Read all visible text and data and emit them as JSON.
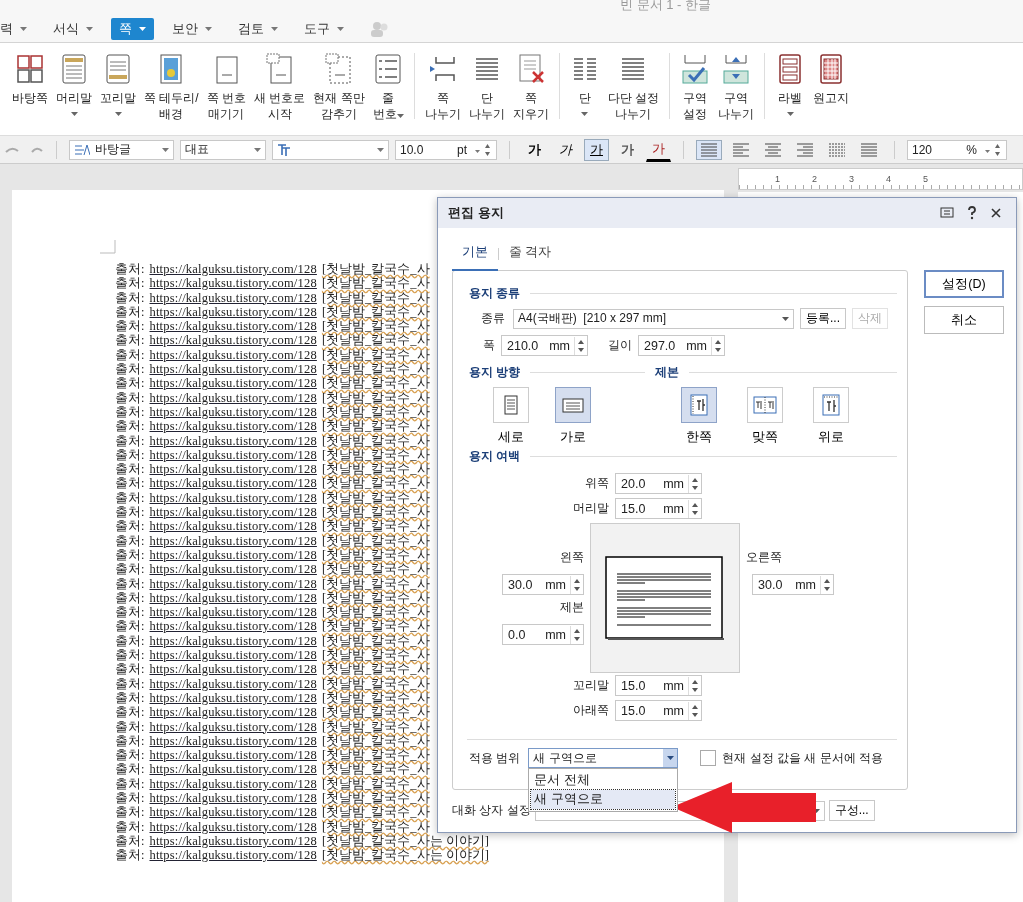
{
  "window": {
    "title": "빈 문서 1 - 한글"
  },
  "menu": [
    {
      "label": "력",
      "selected": false
    },
    {
      "label": "서식",
      "selected": false
    },
    {
      "label": "쪽",
      "selected": true
    },
    {
      "label": "보안",
      "selected": false
    },
    {
      "label": "검토",
      "selected": false
    },
    {
      "label": "도구",
      "selected": false
    }
  ],
  "ribbon": {
    "groups": [
      [
        {
          "label": "바탕쪽",
          "kind": "master",
          "dropdown": false
        },
        {
          "label": "머리말",
          "kind": "header",
          "dropdown": true
        },
        {
          "label": "꼬리말",
          "kind": "footer",
          "dropdown": true
        },
        {
          "label": "쪽 테두리/\n배경",
          "kind": "border",
          "dropdown": false
        },
        {
          "label": "쪽 번호\n매기기",
          "kind": "pagenum",
          "dropdown": false
        },
        {
          "label": "새 번호로\n시작",
          "kind": "newnum",
          "dropdown": false
        },
        {
          "label": "현재 쪽만\n감추기",
          "kind": "hide",
          "dropdown": false
        },
        {
          "label": "줄\n번호",
          "kind": "linenum",
          "dropdown": true
        }
      ],
      [
        {
          "label": "쪽\n나누기",
          "kind": "pagebreak",
          "dropdown": false
        },
        {
          "label": "단\n나누기",
          "kind": "colbreak",
          "dropdown": false
        },
        {
          "label": "쪽\n지우기",
          "kind": "delpage",
          "dropdown": false
        }
      ],
      [
        {
          "label": "단",
          "kind": "columns",
          "dropdown": true
        },
        {
          "label": "다단 설정\n나누기",
          "kind": "multicol",
          "dropdown": false
        }
      ],
      [
        {
          "label": "구역\n설정",
          "kind": "section",
          "dropdown": false
        },
        {
          "label": "구역\n나누기",
          "kind": "sectionbreak",
          "dropdown": false
        }
      ],
      [
        {
          "label": "라벨",
          "kind": "label",
          "dropdown": true
        },
        {
          "label": "원고지",
          "kind": "manuscript",
          "dropdown": false
        }
      ]
    ]
  },
  "format_toolbar": {
    "style": "바탕글",
    "font_group": "대표",
    "size": "10.0",
    "size_unit": "pt",
    "char_buttons": [
      {
        "label": "가",
        "kind": "bold",
        "selected": false
      },
      {
        "label": "가",
        "kind": "italic",
        "selected": false
      },
      {
        "label": "가",
        "kind": "underline",
        "selected": true
      },
      {
        "label": "가",
        "kind": "outline",
        "selected": false
      },
      {
        "label": "가",
        "kind": "color",
        "selected": false
      }
    ],
    "align": [
      {
        "kind": "justify",
        "selected": true
      },
      {
        "kind": "left",
        "selected": false
      },
      {
        "kind": "center",
        "selected": false
      },
      {
        "kind": "right",
        "selected": false
      },
      {
        "kind": "distribute",
        "selected": false
      },
      {
        "kind": "divide",
        "selected": false
      }
    ],
    "zoom": "120",
    "zoom_unit": "%"
  },
  "ruler": {
    "labels": [
      "1",
      "2",
      "3",
      "4",
      "5"
    ]
  },
  "document": {
    "lines": [
      {
        "prefix": "출처:",
        "url": "https://kalguksu.tistory.com/128",
        "title": "[첫날밤_칼국수_사"
      },
      {
        "prefix": "출처:",
        "url": "https://kalguksu.tistory.com/128",
        "title": "[첫날밤_칼국수_사"
      },
      {
        "prefix": "출처:",
        "url": "https://kalguksu.tistory.com/128",
        "title": "[첫날밤_칼국수_사"
      },
      {
        "prefix": "출처:",
        "url": "https://kalguksu.tistory.com/128",
        "title": "[첫날밤_칼국수_사"
      },
      {
        "prefix": "출처:",
        "url": "https://kalguksu.tistory.com/128",
        "title": "[첫날밤_칼국수_사"
      },
      {
        "prefix": "출처:",
        "url": "https://kalguksu.tistory.com/128",
        "title": "[첫날밤_칼국수_사"
      },
      {
        "prefix": "출처:",
        "url": "https://kalguksu.tistory.com/128",
        "title": "[첫날밤_칼국수_사"
      },
      {
        "prefix": "출처:",
        "url": "https://kalguksu.tistory.com/128",
        "title": "[첫날밤_칼국수_사"
      },
      {
        "prefix": "출처:",
        "url": "https://kalguksu.tistory.com/128",
        "title": "[첫날밤_칼국수_사"
      },
      {
        "prefix": "출처:",
        "url": "https://kalguksu.tistory.com/128",
        "title": "[첫날밤_칼국수_사"
      },
      {
        "prefix": "출처:",
        "url": "https://kalguksu.tistory.com/128",
        "title": "[첫날밤_칼국수_사"
      },
      {
        "prefix": "출처:",
        "url": "https://kalguksu.tistory.com/128",
        "title": "[첫날밤_칼국수_사"
      },
      {
        "prefix": "출처:",
        "url": "https://kalguksu.tistory.com/128",
        "title": "[첫날밤_칼국수_사"
      },
      {
        "prefix": "출처:",
        "url": "https://kalguksu.tistory.com/128",
        "title": "[첫날밤_칼국수_사"
      },
      {
        "prefix": "출처:",
        "url": "https://kalguksu.tistory.com/128",
        "title": "[첫날밤_칼국수_사"
      },
      {
        "prefix": "출처:",
        "url": "https://kalguksu.tistory.com/128",
        "title": "[첫날밤_칼국수_사"
      },
      {
        "prefix": "출처:",
        "url": "https://kalguksu.tistory.com/128",
        "title": "[첫날밤_칼국수_사"
      },
      {
        "prefix": "출처:",
        "url": "https://kalguksu.tistory.com/128",
        "title": "[첫날밤_칼국수_사"
      },
      {
        "prefix": "출처:",
        "url": "https://kalguksu.tistory.com/128",
        "title": "[첫날밤_칼국수_사"
      },
      {
        "prefix": "출처:",
        "url": "https://kalguksu.tistory.com/128",
        "title": "[첫날밤_칼국수_사"
      },
      {
        "prefix": "출처:",
        "url": "https://kalguksu.tistory.com/128",
        "title": "[첫날밤_칼국수_사"
      },
      {
        "prefix": "출처:",
        "url": "https://kalguksu.tistory.com/128",
        "title": "[첫날밤_칼국수_사"
      },
      {
        "prefix": "출처:",
        "url": "https://kalguksu.tistory.com/128",
        "title": "[첫날밤_칼국수_사"
      },
      {
        "prefix": "출처:",
        "url": "https://kalguksu.tistory.com/128",
        "title": "[첫날밤_칼국수_사"
      },
      {
        "prefix": "출처:",
        "url": "https://kalguksu.tistory.com/128",
        "title": "[첫날밤_칼국수_사"
      },
      {
        "prefix": "출처:",
        "url": "https://kalguksu.tistory.com/128",
        "title": "[첫날밤_칼국수_사"
      },
      {
        "prefix": "출처:",
        "url": "https://kalguksu.tistory.com/128",
        "title": "[첫날밤_칼국수_사"
      },
      {
        "prefix": "출처:",
        "url": "https://kalguksu.tistory.com/128",
        "title": "[첫날밤_칼국수_사"
      },
      {
        "prefix": "출처:",
        "url": "https://kalguksu.tistory.com/128",
        "title": "[첫날밤_칼국수_사"
      },
      {
        "prefix": "출처:",
        "url": "https://kalguksu.tistory.com/128",
        "title": "[첫날밤_칼국수_사"
      },
      {
        "prefix": "출처:",
        "url": "https://kalguksu.tistory.com/128",
        "title": "[첫날밤_칼국수_사"
      },
      {
        "prefix": "출처:",
        "url": "https://kalguksu.tistory.com/128",
        "title": "[첫날밤_칼국수_사"
      },
      {
        "prefix": "출처:",
        "url": "https://kalguksu.tistory.com/128",
        "title": "[첫날밤_칼국수_사"
      },
      {
        "prefix": "출처:",
        "url": "https://kalguksu.tistory.com/128",
        "title": "[첫날밤_칼국수_사"
      },
      {
        "prefix": "출처:",
        "url": "https://kalguksu.tistory.com/128",
        "title": "[첫날밤_칼국수_사"
      },
      {
        "prefix": "출처:",
        "url": "https://kalguksu.tistory.com/128",
        "title": "[첫날밤_칼국수_사"
      },
      {
        "prefix": "출처:",
        "url": "https://kalguksu.tistory.com/128",
        "title": "[첫날밤_칼국수_사"
      },
      {
        "prefix": "출처:",
        "url": "https://kalguksu.tistory.com/128",
        "title": "[첫날밤_칼국수_사"
      },
      {
        "prefix": "출처:",
        "url": "https://kalguksu.tistory.com/128",
        "title": "[첫날밤_칼국수_사"
      },
      {
        "prefix": "출처:",
        "url": "https://kalguksu.tistory.com/128",
        "title": "[첫날밤_칼국수_사"
      },
      {
        "prefix": "출처:",
        "url": "https://kalguksu.tistory.com/128",
        "title": "[첫날밤_칼국수_사는 이야기]"
      },
      {
        "prefix": "출처:",
        "url": "https://kalguksu.tistory.com/128",
        "title": "[첫날밤_칼국수_사는 이야기]"
      }
    ]
  },
  "dialog": {
    "title": "편집 용지",
    "tabs": [
      {
        "label": "기본",
        "selected": true
      },
      {
        "label": "줄 격자",
        "selected": false
      }
    ],
    "buttons": [
      {
        "label": "설정(D)",
        "default": true
      },
      {
        "label": "취소",
        "default": false
      }
    ],
    "paper_type": {
      "heading": "용지 종류",
      "type_label": "종류",
      "type_value": "A4(국배판)  [210 x 297 mm]",
      "register": "등록...",
      "delete": {
        "label": "삭제",
        "disabled": true
      },
      "size_fields": [
        {
          "label": "폭",
          "value": "210.0",
          "unit": "mm"
        },
        {
          "label": "길이",
          "value": "297.0",
          "unit": "mm"
        }
      ]
    },
    "orientation": {
      "heading": "용지 방향",
      "options": [
        {
          "label": "세로",
          "kind": "portrait",
          "selected": false
        },
        {
          "label": "가로",
          "kind": "landscape",
          "selected": true
        }
      ]
    },
    "binding": {
      "heading": "제본",
      "options": [
        {
          "label": "한쪽",
          "kind": "single",
          "selected": true
        },
        {
          "label": "맞쪽",
          "kind": "facing",
          "selected": false
        },
        {
          "label": "위로",
          "kind": "top",
          "selected": false
        }
      ]
    },
    "margins": {
      "heading": "용지 여백",
      "top_fields": [
        {
          "label": "위쪽",
          "value": "20.0",
          "unit": "mm"
        },
        {
          "label": "머리말",
          "value": "15.0",
          "unit": "mm"
        }
      ],
      "left_fields": [
        {
          "label": "왼쪽",
          "value": "30.0",
          "unit": "mm"
        },
        {
          "label": "제본",
          "value": "0.0",
          "unit": "mm"
        }
      ],
      "right_fields": [
        {
          "label": "오른쪽",
          "value": "30.0",
          "unit": "mm"
        }
      ],
      "bottom_fields": [
        {
          "label": "꼬리말",
          "value": "15.0",
          "unit": "mm"
        },
        {
          "label": "아래쪽",
          "value": "15.0",
          "unit": "mm"
        }
      ]
    },
    "apply": {
      "label": "적용 범위",
      "value": "새 구역으로",
      "expanded": true,
      "options": [
        {
          "label": "문서 전체",
          "selected": false
        },
        {
          "label": "새 구역으로",
          "selected": true
        }
      ]
    },
    "default_checkbox": {
      "label": "현재 설정 값을 새 문서에 적용",
      "checked": false
    },
    "dialog_settings": {
      "label": "대화 상자 설정",
      "button": "구성..."
    }
  }
}
